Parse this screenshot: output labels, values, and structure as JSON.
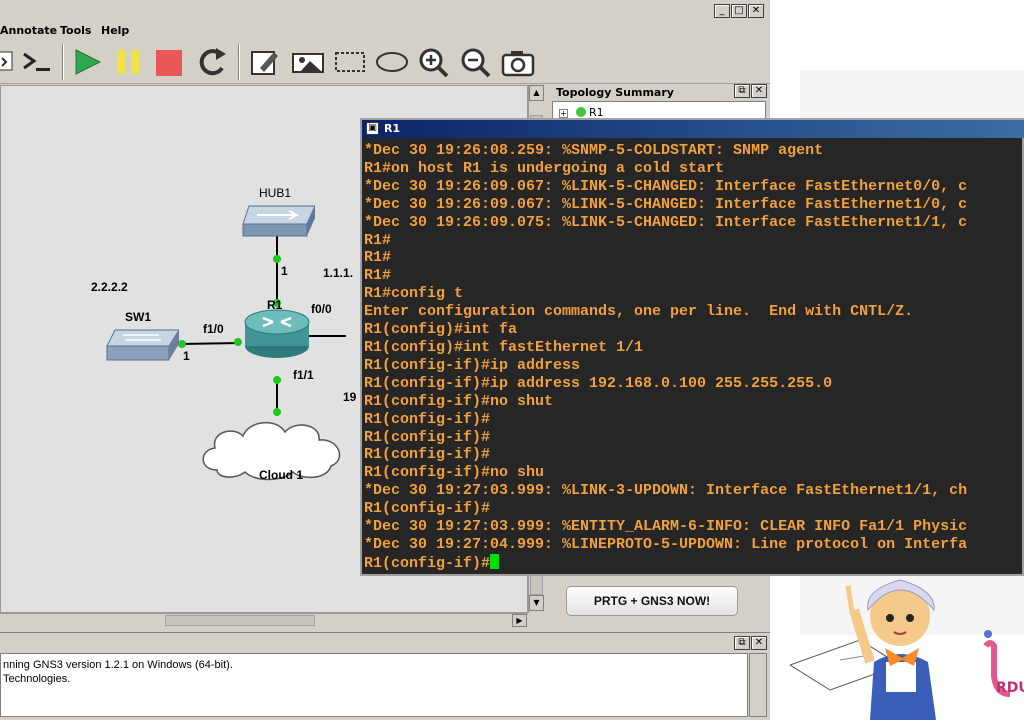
{
  "menubar": {
    "items": [
      "Annotate",
      "Tools",
      "Help"
    ]
  },
  "toolbar": {
    "buttons": [
      "console-all-icon",
      "terminal-icon",
      "start-icon",
      "pause-icon",
      "stop-icon",
      "reload-icon",
      "note-icon",
      "image-icon",
      "rectangle-icon",
      "ellipse-icon",
      "zoom-in-icon",
      "zoom-out-icon",
      "screenshot-icon"
    ]
  },
  "colors": {
    "start": "#2fa84f",
    "pause": "#f2e24a",
    "stop": "#e85858",
    "terminal_text": "#f0a03c",
    "cursor": "#00e000"
  },
  "topology": {
    "hub_label": "HUB1",
    "router_label": "R1",
    "switch_label": "SW1",
    "cloud_label": "Cloud 1",
    "hub_port": "1",
    "sw_port": "1",
    "r1_f10": "f1/0",
    "r1_f11": "f1/1",
    "r1_f00": "f0/0",
    "ip_left": "2.2.2.2",
    "ip_right": "1.1.1.",
    "ip_partial": "19"
  },
  "dock": {
    "title": "Topology Summary",
    "node": "R1",
    "promo_button": "PRTG + GNS3 NOW!"
  },
  "console": {
    "lines": [
      "nning GNS3 version 1.2.1 on Windows (64-bit).",
      "Technologies."
    ]
  },
  "terminal": {
    "title": "R1",
    "lines": [
      "*Dec 30 19:26:08.259: %SNMP-5-COLDSTART: SNMP agent",
      "R1#on host R1 is undergoing a cold start",
      "*Dec 30 19:26:09.067: %LINK-5-CHANGED: Interface FastEthernet0/0, c",
      "*Dec 30 19:26:09.067: %LINK-5-CHANGED: Interface FastEthernet1/0, c",
      "*Dec 30 19:26:09.075: %LINK-5-CHANGED: Interface FastEthernet1/1, c",
      "R1#",
      "R1#",
      "R1#",
      "R1#config t",
      "Enter configuration commands, one per line.  End with CNTL/Z.",
      "R1(config)#int fa",
      "R1(config)#int fastEthernet 1/1",
      "R1(config-if)#ip address",
      "R1(config-if)#ip address 192.168.0.100 255.255.255.0",
      "R1(config-if)#no shut",
      "R1(config-if)#",
      "R1(config-if)#",
      "R1(config-if)#",
      "R1(config-if)#no shu",
      "*Dec 30 19:27:03.999: %LINK-3-UPDOWN: Interface FastEthernet1/1, ch",
      "R1(config-if)#",
      "*Dec 30 19:27:03.999: %ENTITY_ALARM-6-INFO: CLEAR INFO Fa1/1 Physic",
      "*Dec 30 19:27:04.999: %LINEPROTO-5-UPDOWN: Line protocol on Interfa"
    ],
    "prompt": "R1(config-if)#"
  },
  "logo_text": "RDU"
}
